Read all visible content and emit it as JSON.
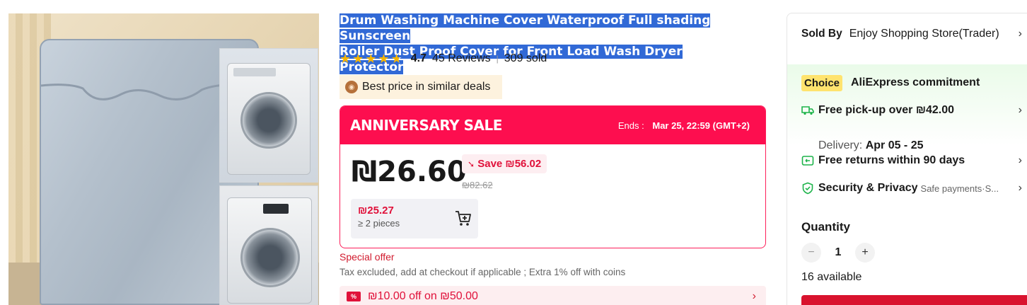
{
  "product": {
    "title_line1": "Drum Washing Machine Cover Waterproof Full shading Sunscreen",
    "title_line2": "Roller Dust Proof Cover for Front Load Wash Dryer Protector",
    "rating": 4.7,
    "rating_text": "4.7",
    "reviews": "45 Reviews",
    "sold": "309 sold",
    "best_price_label": "Best price in similar deals"
  },
  "sale": {
    "name": "ANNIVERSARY SALE",
    "ends_label": "Ends :",
    "ends_value": "Mar 25, 22:59 (GMT+2)",
    "price": "₪26.60",
    "save_label": "Save ₪56.02",
    "original_price": "₪82.62",
    "tier_price": "₪25.27",
    "tier_qty": "≥ 2 pieces"
  },
  "offer": {
    "special_offer": "Special offer",
    "tax_note": "Tax excluded, add at checkout if applicable ; Extra 1% off with coins",
    "coupon_tag": "%",
    "coupon_text": "₪10.00 off on ₪50.00"
  },
  "seller": {
    "sold_by_label": "Sold By",
    "store_name": "Enjoy Shopping Store(Trader)"
  },
  "commitment": {
    "choice_label": "Choice",
    "title": "AliExpress commitment",
    "pickup": "Free pick-up over ₪42.00",
    "delivery_label": "Delivery:",
    "delivery_dates": "Apr 05 - 25",
    "returns": "Free returns within 90 days",
    "security": "Security & Privacy",
    "security_sub": "Safe payments·S..."
  },
  "quantity": {
    "label": "Quantity",
    "minus": "−",
    "value": "1",
    "plus": "+",
    "available": "16 available"
  },
  "colors": {
    "sale_red": "#fd0e4f",
    "price_red": "#e0113a",
    "choice_yellow": "#ffe36e",
    "title_highlight": "#3169d6",
    "star": "#f7b500"
  }
}
